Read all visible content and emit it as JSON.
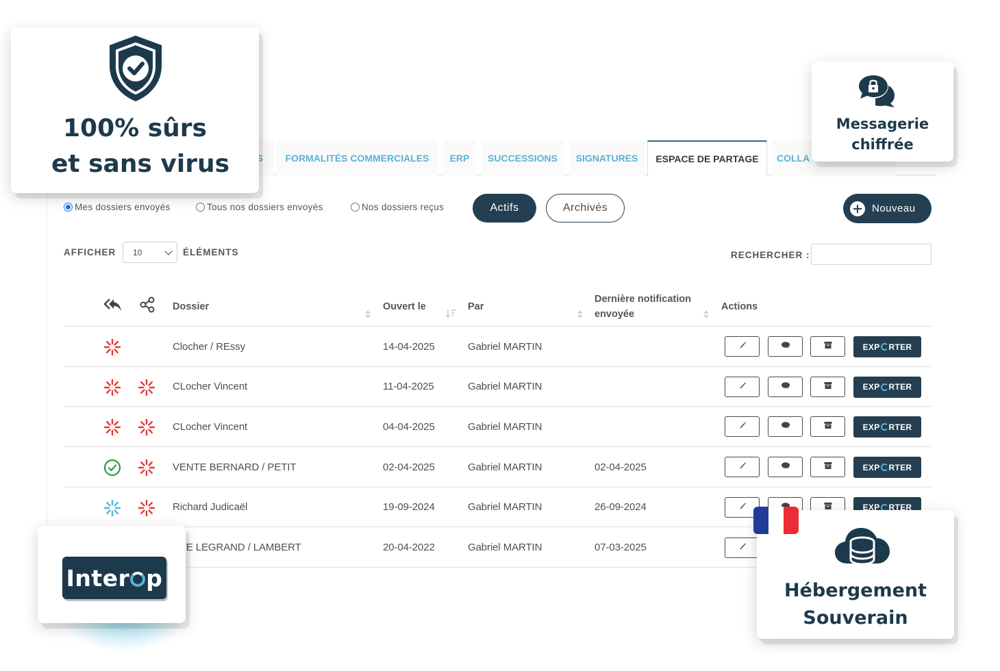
{
  "tabs": [
    {
      "label": "S",
      "active": false
    },
    {
      "label": "FORMALITÉS COMMERCIALES",
      "active": false
    },
    {
      "label": "ERP",
      "active": false
    },
    {
      "label": "SUCCESSIONS",
      "active": false
    },
    {
      "label": "SIGNATURES",
      "active": false
    },
    {
      "label": "ESPACE DE PARTAGE",
      "active": true
    },
    {
      "label": "COLLA",
      "active": false
    }
  ],
  "filters": {
    "radios": [
      {
        "label": "Mes dossiers envoyés",
        "checked": true
      },
      {
        "label": "Tous nos dossiers envoyés",
        "checked": false
      },
      {
        "label": "Nos dossiers reçus",
        "checked": false
      }
    ],
    "active_label": "Actifs",
    "archived_label": "Archivés",
    "new_label": "Nouveau"
  },
  "list_controls": {
    "show_label": "AFFICHER",
    "page_size": "10",
    "items_label": "ÉLÉMENTS",
    "search_label": "RECHERCHER :",
    "search_value": ""
  },
  "table": {
    "headers": {
      "dossier": "Dossier",
      "opened": "Ouvert le",
      "by": "Par",
      "last_notif_1": "Dernière notification",
      "last_notif_2": "envoyée",
      "actions": "Actions"
    },
    "export_prefix": "EXP",
    "export_suffix": "RTER",
    "rows": [
      {
        "status_reply": "pending-red",
        "status_share": "",
        "dossier": "Clocher / REssy",
        "opened": "14-04-2025",
        "by": "Gabriel MARTIN",
        "last_notif": ""
      },
      {
        "status_reply": "pending-red",
        "status_share": "pending-red",
        "dossier": "CLocher Vincent",
        "opened": "11-04-2025",
        "by": "Gabriel MARTIN",
        "last_notif": ""
      },
      {
        "status_reply": "pending-red",
        "status_share": "pending-red",
        "dossier": "CLocher Vincent",
        "opened": "04-04-2025",
        "by": "Gabriel MARTIN",
        "last_notif": ""
      },
      {
        "status_reply": "done-green",
        "status_share": "pending-red",
        "dossier": "VENTE BERNARD / PETIT",
        "opened": "02-04-2025",
        "by": "Gabriel MARTIN",
        "last_notif": "02-04-2025"
      },
      {
        "status_reply": "pending-blue",
        "status_share": "pending-red",
        "dossier": "Richard Judicaël",
        "opened": "19-09-2024",
        "by": "Gabriel MARTIN",
        "last_notif": "26-09-2024"
      },
      {
        "status_reply": "",
        "status_share": "",
        "dossier": "NTE LEGRAND / LAMBERT",
        "opened": "20-04-2022",
        "by": "Gabriel MARTIN",
        "last_notif": "07-03-2025"
      }
    ]
  },
  "cards": {
    "security": {
      "line1": "100% sûrs",
      "line2": "et sans virus",
      "icon": "shield-check-icon"
    },
    "messaging": {
      "line1": "Messagerie",
      "line2": "chiffrée",
      "icon": "locked-chat-icon"
    },
    "hosting": {
      "line1": "Hébergement",
      "line2": "Souverain",
      "icon": "cloud-database-icon"
    },
    "interop": {
      "prefix": "Inter",
      "suffix": "p"
    }
  },
  "colors": {
    "navy": "#253f52",
    "tab_blue": "#5ab2d5",
    "pending_red": "#e53935",
    "done_green": "#2e9b3e",
    "pending_blue": "#4db8d8",
    "flag_blue": "#1f3c99",
    "flag_white": "#ffffff",
    "flag_red": "#ee2a35"
  }
}
